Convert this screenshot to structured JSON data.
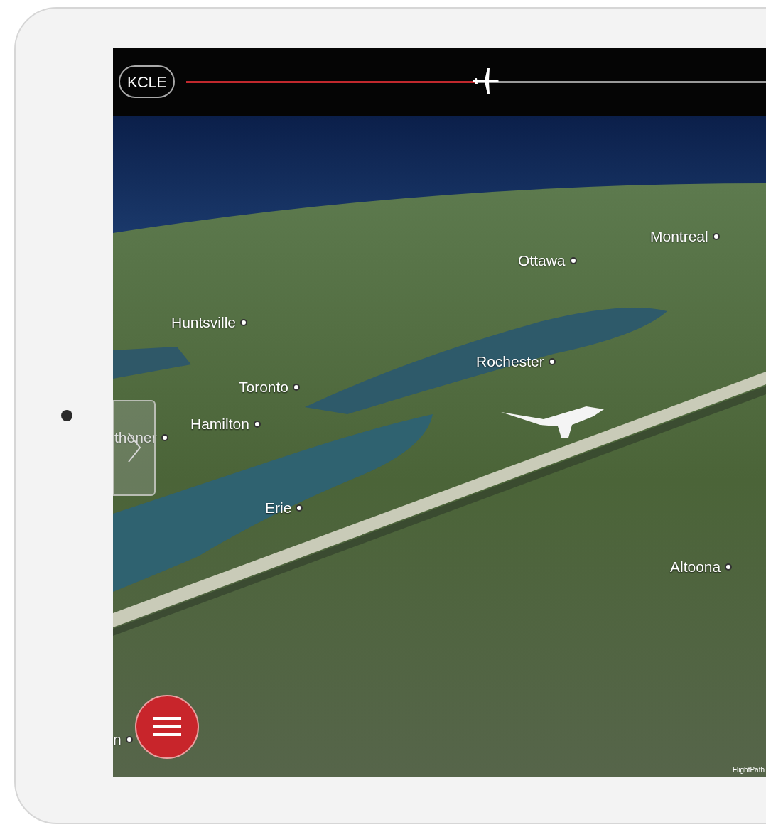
{
  "top_bar": {
    "origin": "KCLE",
    "progress": {
      "level": 0.5
    }
  },
  "map": {
    "cities": [
      {
        "name": "Montreal"
      },
      {
        "name": "Ottawa"
      },
      {
        "name": "Huntsville"
      },
      {
        "name": "Rochester"
      },
      {
        "name": "Toronto"
      },
      {
        "name": "Hamilton"
      },
      {
        "name": "thener"
      },
      {
        "name": "Erie"
      },
      {
        "name": "Altoona"
      },
      {
        "name": "n"
      }
    ],
    "attribution": "FlightPath"
  }
}
